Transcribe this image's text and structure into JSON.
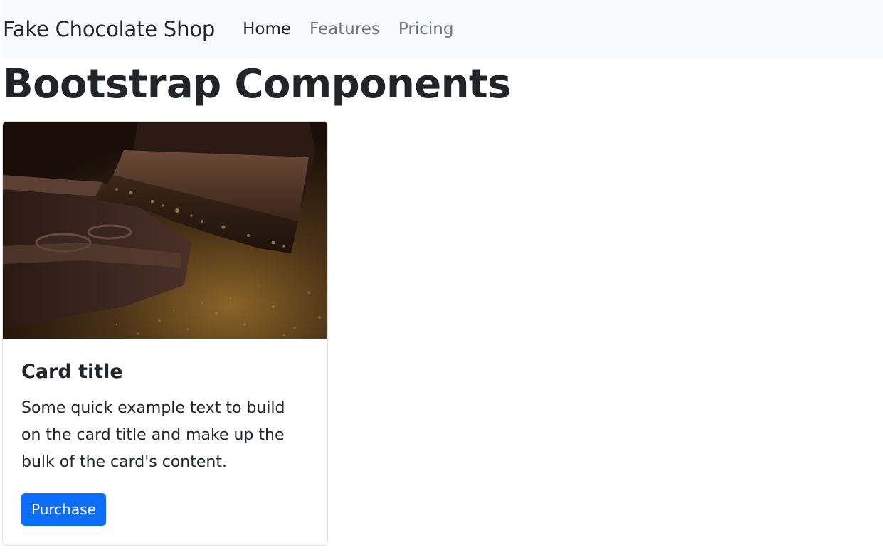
{
  "navbar": {
    "brand": "Fake Chocolate Shop",
    "links": [
      {
        "label": "Home",
        "active": true
      },
      {
        "label": "Features",
        "active": false
      },
      {
        "label": "Pricing",
        "active": false
      }
    ]
  },
  "page": {
    "title": "Bootstrap Components"
  },
  "card": {
    "image": "chocolate-bars-photo",
    "title": "Card title",
    "text": "Some quick example text to build on the card title and make up the bulk of the card's content.",
    "button_label": "Purchase"
  },
  "colors": {
    "navbar_bg": "#f8f9fa",
    "text": "#212529",
    "muted": "#6c757d",
    "primary": "#0d6efd"
  }
}
